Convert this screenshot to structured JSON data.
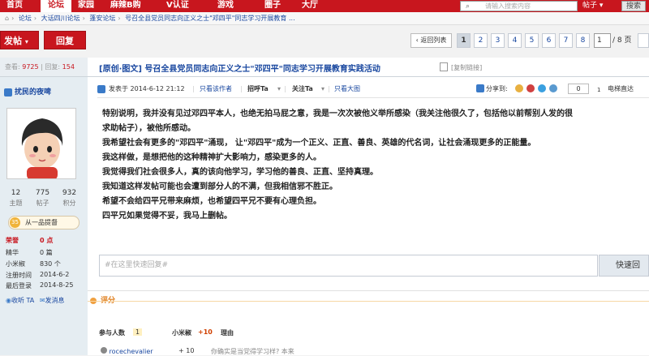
{
  "topnav": {
    "items": [
      "首页",
      "论坛",
      "家园",
      "麻辣B购",
      "V认证",
      "游戏",
      "圈子",
      "大厅"
    ],
    "selected_index": 1,
    "search_placeholder": "请输入搜索内容",
    "scope_label": "帖子",
    "search_button": "搜索"
  },
  "breadcrumb": {
    "items": [
      "论坛",
      "大话四川论坛",
      "蓬安论坛",
      "号召全县党员同志向正义之士\"邓四平\"同志学习开展教育 ..."
    ]
  },
  "actions": {
    "post_label": "发帖",
    "reply_label": "回复",
    "back_label": "返回列表"
  },
  "pagination": {
    "pages": [
      "1",
      "2",
      "3",
      "4",
      "5",
      "6",
      "7",
      "8"
    ],
    "current": "1",
    "input_value": "1",
    "total": "/ 8 页"
  },
  "thread_stats": {
    "views_label": "查看:",
    "views": "9725",
    "sep": "|",
    "replies_label": "回复:",
    "replies": "154"
  },
  "thread": {
    "title": "[原创·图文] 号召全县党员同志向正义之士\"邓四平\"同志学习开展教育实践活动",
    "copy_link": "[复制链接]"
  },
  "author": {
    "name": "扰民的夜啤",
    "stats": [
      {
        "value": "12",
        "label": "主题"
      },
      {
        "value": "775",
        "label": "帖子"
      },
      {
        "value": "932",
        "label": "积分"
      }
    ],
    "rank_badge": "35",
    "rank": "从一品提督",
    "fields": [
      {
        "key": "荣誉",
        "value": "0 点"
      },
      {
        "key": "精华",
        "value": "0 篇"
      },
      {
        "key": "小米椒",
        "value": "830 个"
      },
      {
        "key": "注册时间",
        "value": "2014-6-2"
      },
      {
        "key": "最后登录",
        "value": "2014-8-25"
      }
    ],
    "follow_label": "收听 TA",
    "message_label": "发消息"
  },
  "post_meta": {
    "posted_at": "发表于 2014-6-12 21:12",
    "sep": "|",
    "only_author": "只看该作者",
    "greet": "招呼Ta",
    "follow": "关注Ta",
    "large_image": "只看大图",
    "share_label": "分享到:",
    "share_count": "0",
    "floor_suffix": "1",
    "floor_label": "电梯直达"
  },
  "post_body": [
    "特别说明，我并没有见过邓四平本人，也绝无拍马屁之意，我是一次次被他义举所感染（我关注他很久了，包括他以前帮别人发的很",
    "求助帖子），被他所感动。",
    "我希望社会有更多的\"邓四平\"涌现，  让\"邓四平\"成为一个正义、正直、善良、英雄的代名词，让社会涌现更多的正能量。",
    "我这样做，是想把他的这种精神扩大影响力，感染更多的人。",
    "我觉得我们社会很多人，真的该向他学习，学习他的善良、正直、坚持真理。",
    "我知道这样发帖可能也会遭到部分人的不满，但我相信邪不胜正。",
    "希望不会给四平兄带来麻烦，也希望四平兄不要有心理负担。",
    "四平兄如果觉得不妥，我马上删帖。"
  ],
  "quick_reply": {
    "placeholder": "#在这里快速回复#",
    "button": "快速回"
  },
  "rating": {
    "label": "评分",
    "participants_label": "参与人数",
    "participants": "1",
    "currency": "小米椒",
    "points": "+10",
    "reason_label": "理由",
    "row_user": "rocechevalier",
    "row_value": "+ 10",
    "row_reason": "你确实是当党得学习样? 本来"
  },
  "colors": {
    "brand_red": "#c8161e",
    "link_blue": "#1a48a0",
    "sidebar_bg": "#e5edf2"
  }
}
